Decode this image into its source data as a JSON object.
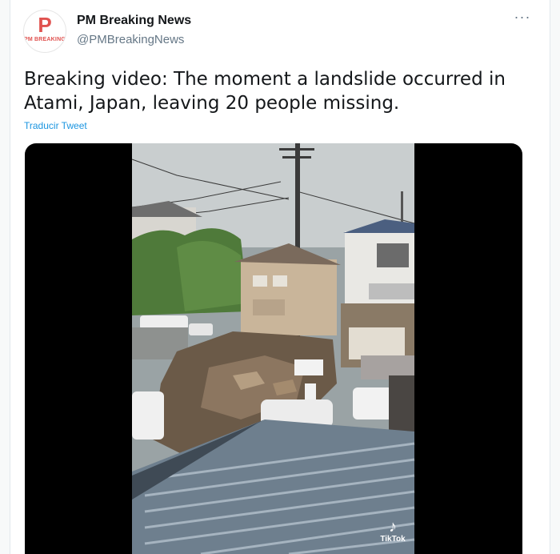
{
  "tweet": {
    "author_name": "PM Breaking News",
    "author_handle": "@PMBreakingNews",
    "avatar_letter": "P",
    "avatar_text": "PM BREAKING",
    "text": "Breaking video: The moment a landslide occurred in Atami, Japan, leaving 20 people missing.",
    "translate_label": "Traducir Tweet",
    "more_label": "···"
  },
  "media": {
    "watermark_icon": "tiktok-note-icon",
    "watermark_label": "TikTok"
  },
  "colors": {
    "link": "#1b95e0",
    "text": "#14171a",
    "secondary": "#657786",
    "brand": "#e0524f"
  }
}
